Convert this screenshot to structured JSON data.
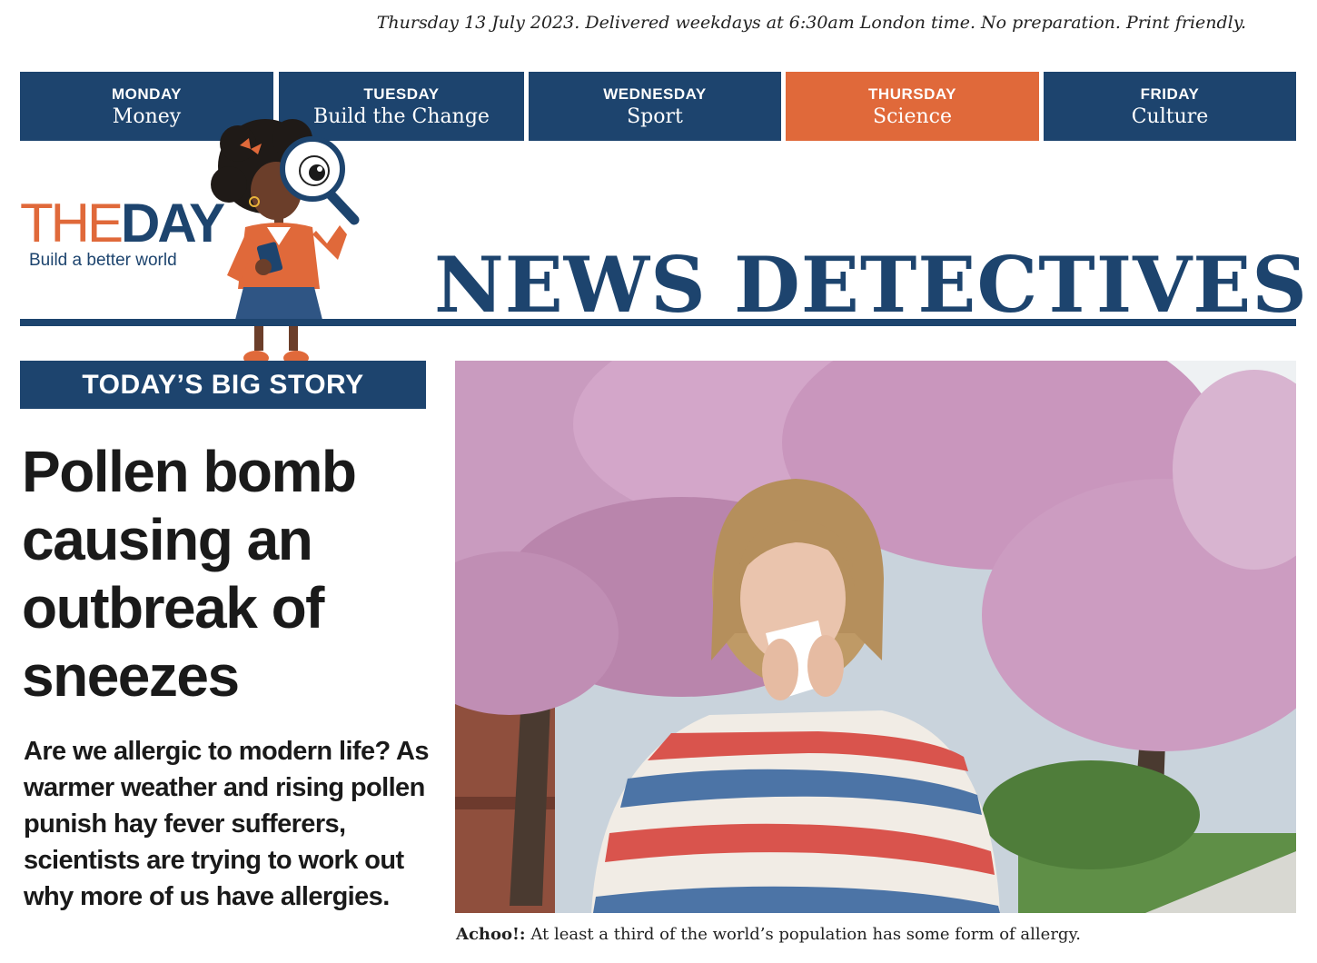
{
  "dateline": "Thursday 13 July 2023. Delivered weekdays at 6:30am London time. No preparation. Print friendly.",
  "day_tabs": [
    {
      "day": "MONDAY",
      "topic": "Money",
      "active": false
    },
    {
      "day": "TUESDAY",
      "topic": "Build the Change",
      "active": false
    },
    {
      "day": "WEDNESDAY",
      "topic": "Sport",
      "active": false
    },
    {
      "day": "THURSDAY",
      "topic": "Science",
      "active": true
    },
    {
      "day": "FRIDAY",
      "topic": "Culture",
      "active": false
    }
  ],
  "logo": {
    "the": "THE",
    "day": "DAY",
    "tagline": "Build a better world"
  },
  "masthead": "NEWS DETECTIVES",
  "section": "TODAY’S BIG STORY",
  "article": {
    "headline": "Pollen bomb causing an outbreak of sneezes",
    "standfirst": "Are we allergic to modern life? As warmer weather and rising pollen punish hay fever sufferers, scientists are trying to work out why more of us have allergies."
  },
  "caption": {
    "lead": "Achoo!:",
    "text": "At least a third of the world’s population has some form of allergy."
  },
  "colors": {
    "navy": "#1d446e",
    "orange": "#e0693a"
  },
  "icons": {
    "mascot": "detective-girl-magnifier-illustration"
  }
}
